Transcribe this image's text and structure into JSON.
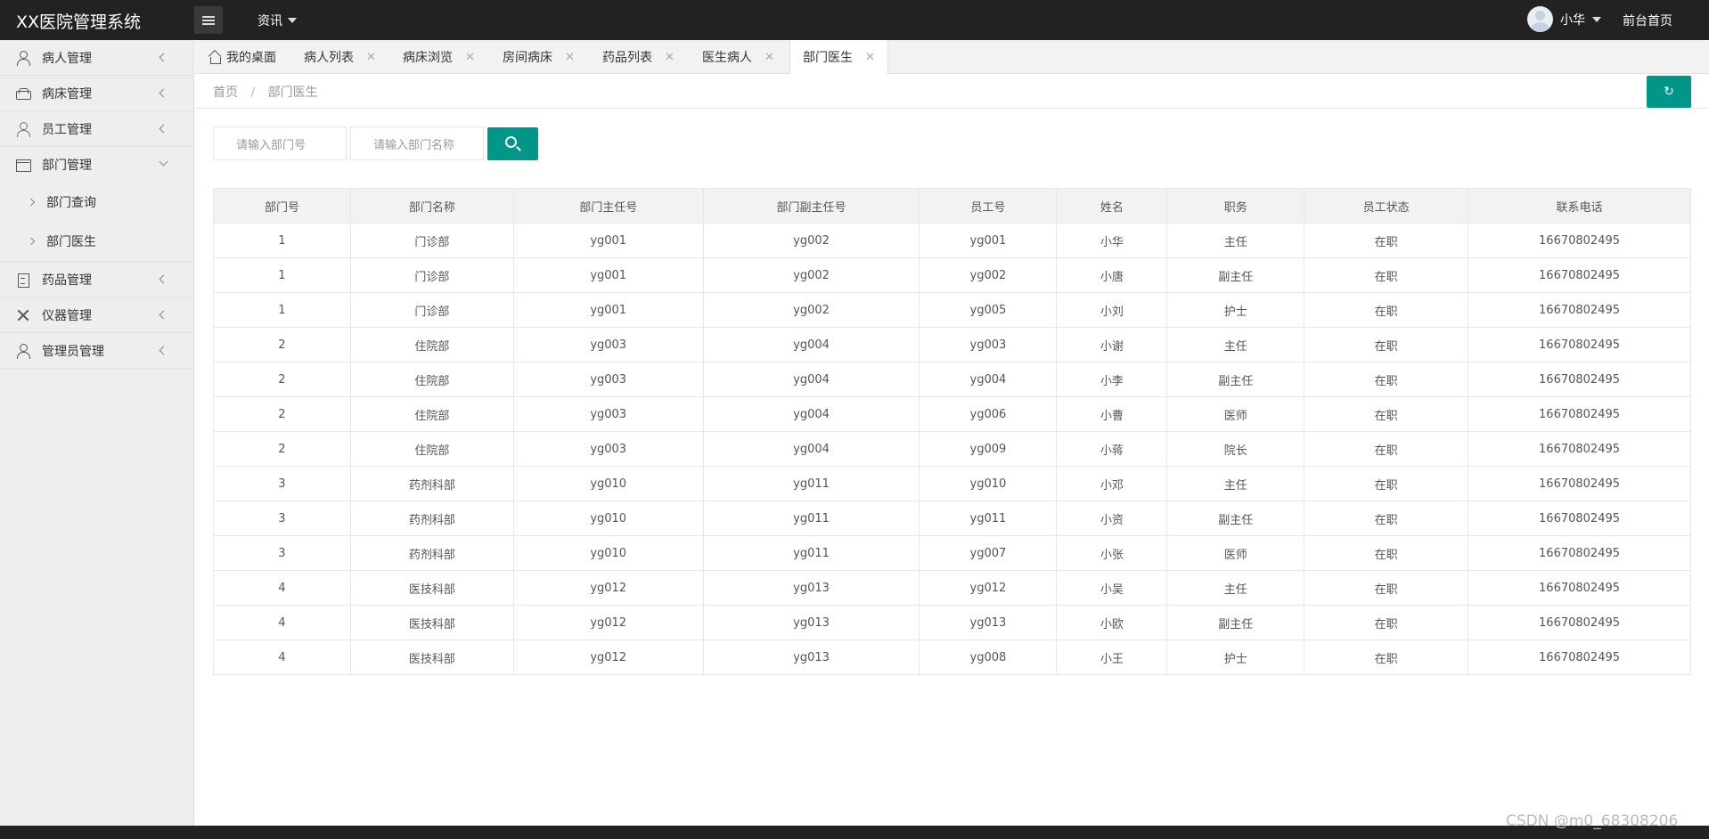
{
  "header": {
    "logo": "XX医院管理系统",
    "nav_info": "资讯",
    "user_name": "小华",
    "front_link": "前台首页"
  },
  "sidebar": {
    "items": [
      {
        "label": "病人管理",
        "icon": "person-icon"
      },
      {
        "label": "病床管理",
        "icon": "bed-icon"
      },
      {
        "label": "员工管理",
        "icon": "staff-icon"
      },
      {
        "label": "部门管理",
        "icon": "dept-icon"
      },
      {
        "label": "药品管理",
        "icon": "drug-icon"
      },
      {
        "label": "仪器管理",
        "icon": "tool-icon"
      },
      {
        "label": "管理员管理",
        "icon": "admin-icon"
      }
    ],
    "sub_items": [
      "部门查询",
      "部门医生"
    ]
  },
  "tabs": [
    {
      "label": "我的桌面"
    },
    {
      "label": "病人列表"
    },
    {
      "label": "病床浏览"
    },
    {
      "label": "房间病床"
    },
    {
      "label": "药品列表"
    },
    {
      "label": "医生病人"
    },
    {
      "label": "部门医生"
    }
  ],
  "breadcrumb": {
    "home": "首页",
    "sep": "/",
    "current": "部门医生"
  },
  "search": {
    "dept_no_placeholder": "请输入部门号",
    "dept_name_placeholder": "请输入部门名称"
  },
  "table": {
    "headers": [
      "部门号",
      "部门名称",
      "部门主任号",
      "部门副主任号",
      "员工号",
      "姓名",
      "职务",
      "员工状态",
      "联系电话"
    ],
    "rows": [
      [
        "1",
        "门诊部",
        "yg001",
        "yg002",
        "yg001",
        "小华",
        "主任",
        "在职",
        "16670802495"
      ],
      [
        "1",
        "门诊部",
        "yg001",
        "yg002",
        "yg002",
        "小唐",
        "副主任",
        "在职",
        "16670802495"
      ],
      [
        "1",
        "门诊部",
        "yg001",
        "yg002",
        "yg005",
        "小刘",
        "护士",
        "在职",
        "16670802495"
      ],
      [
        "2",
        "住院部",
        "yg003",
        "yg004",
        "yg003",
        "小谢",
        "主任",
        "在职",
        "16670802495"
      ],
      [
        "2",
        "住院部",
        "yg003",
        "yg004",
        "yg004",
        "小李",
        "副主任",
        "在职",
        "16670802495"
      ],
      [
        "2",
        "住院部",
        "yg003",
        "yg004",
        "yg006",
        "小曹",
        "医师",
        "在职",
        "16670802495"
      ],
      [
        "2",
        "住院部",
        "yg003",
        "yg004",
        "yg009",
        "小蒋",
        "院长",
        "在职",
        "16670802495"
      ],
      [
        "3",
        "药剂科部",
        "yg010",
        "yg011",
        "yg010",
        "小邓",
        "主任",
        "在职",
        "16670802495"
      ],
      [
        "3",
        "药剂科部",
        "yg010",
        "yg011",
        "yg011",
        "小资",
        "副主任",
        "在职",
        "16670802495"
      ],
      [
        "3",
        "药剂科部",
        "yg010",
        "yg011",
        "yg007",
        "小张",
        "医师",
        "在职",
        "16670802495"
      ],
      [
        "4",
        "医技科部",
        "yg012",
        "yg013",
        "yg012",
        "小吴",
        "主任",
        "在职",
        "16670802495"
      ],
      [
        "4",
        "医技科部",
        "yg012",
        "yg013",
        "yg013",
        "小欧",
        "副主任",
        "在职",
        "16670802495"
      ],
      [
        "4",
        "医技科部",
        "yg012",
        "yg013",
        "yg008",
        "小王",
        "护士",
        "在职",
        "16670802495"
      ]
    ]
  },
  "watermark": "CSDN @m0_68308206",
  "colors": {
    "accent": "#009688",
    "header_bg": "#222222",
    "sidebar_bg": "#eeeeee"
  }
}
